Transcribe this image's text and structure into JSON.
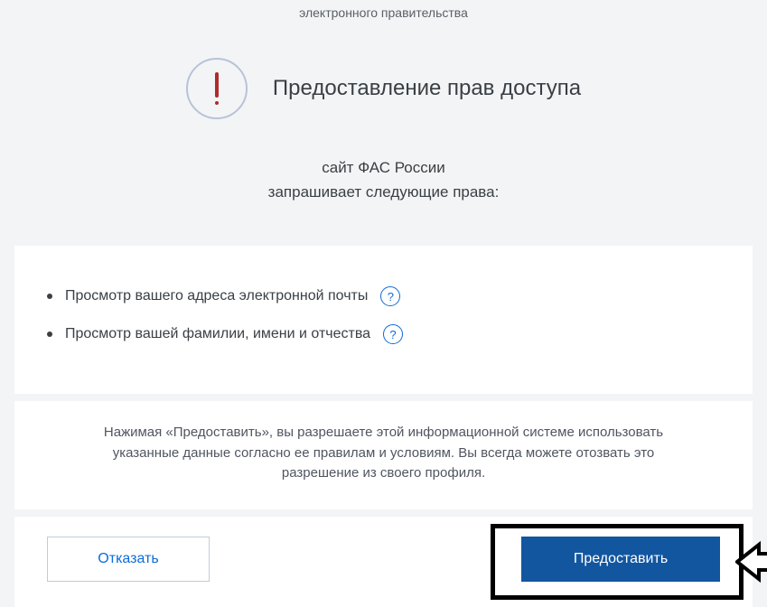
{
  "headerFragment": "электронного правительства",
  "title": "Предоставление прав доступа",
  "requester": "сайт ФАС России",
  "requestLine": "запрашивает следующие права:",
  "permissions": [
    "Просмотр вашего адреса электронной почты",
    "Просмотр вашей фамилии, имени и отчества"
  ],
  "disclosure": "Нажимая «Предоставить», вы разрешаете этой информационной системе использовать указанные данные согласно ее правилам и условиям. Вы всегда можете отозвать это разрешение из своего профиля.",
  "buttons": {
    "decline": "Отказать",
    "grant": "Предоставить"
  }
}
